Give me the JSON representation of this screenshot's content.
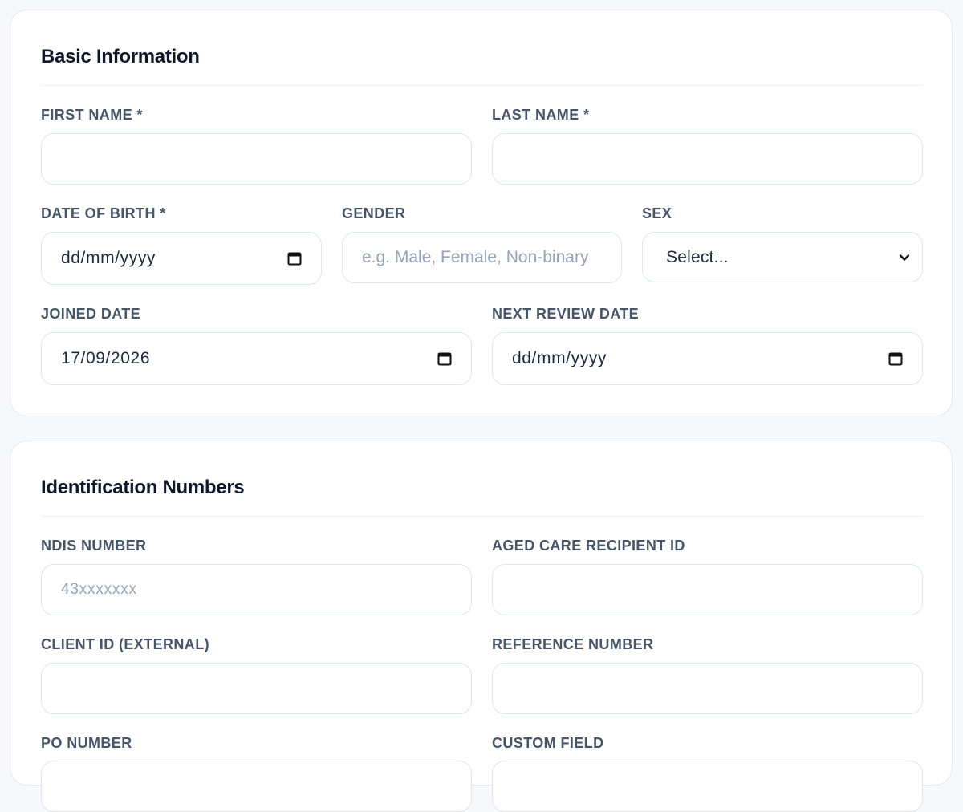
{
  "basic": {
    "title": "Basic Information",
    "first_name": {
      "label": "FIRST NAME *",
      "value": ""
    },
    "last_name": {
      "label": "LAST NAME *",
      "value": ""
    },
    "dob": {
      "label": "DATE OF BIRTH *",
      "value": "dd/mm/yyyy"
    },
    "gender": {
      "label": "GENDER",
      "placeholder": "e.g. Male, Female, Non-binary"
    },
    "sex": {
      "label": "SEX",
      "value": "Select..."
    },
    "joined": {
      "label": "JOINED DATE",
      "value": "17/09/2026"
    },
    "next_review": {
      "label": "NEXT REVIEW DATE",
      "value": "dd/mm/yyyy"
    }
  },
  "ids": {
    "title": "Identification Numbers",
    "ndis": {
      "label": "NDIS NUMBER",
      "placeholder": "43xxxxxxx"
    },
    "aged_care": {
      "label": "AGED CARE RECIPIENT ID",
      "value": ""
    },
    "client_id": {
      "label": "CLIENT ID (EXTERNAL)",
      "value": ""
    },
    "reference": {
      "label": "REFERENCE NUMBER",
      "value": ""
    },
    "po": {
      "label": "PO NUMBER",
      "value": ""
    },
    "custom": {
      "label": "CUSTOM FIELD",
      "value": ""
    }
  },
  "icons": {
    "calendar": "calendar-icon",
    "chevron": "chevron-down-icon"
  },
  "colors": {
    "label": "#475569",
    "placeholder": "#94a3b8",
    "border": "#dfe5ec",
    "background": "#f6f8fb"
  }
}
